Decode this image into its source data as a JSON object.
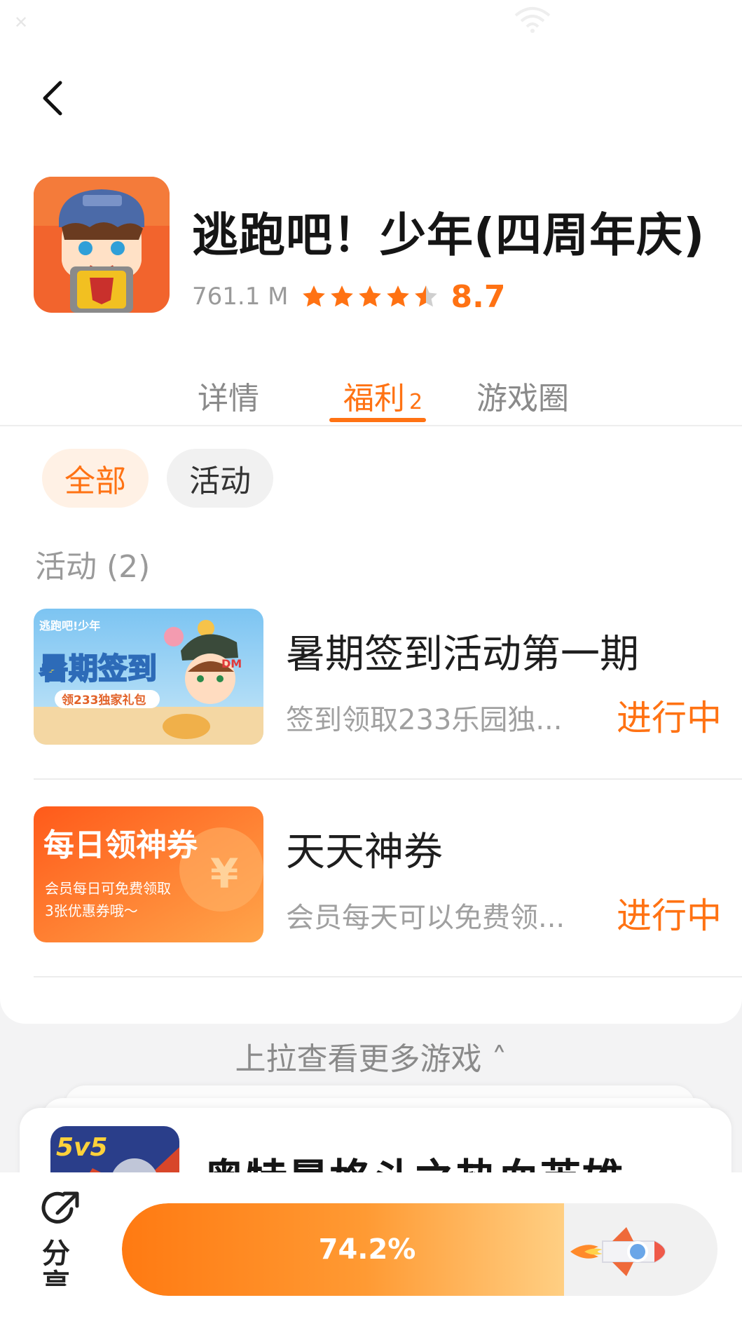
{
  "status_bar": {
    "left_glyph": "✕"
  },
  "header": {
    "back_icon": "chevron-left-icon"
  },
  "app": {
    "title": "逃跑吧！少年(四周年庆)",
    "size": "761.1 M",
    "rating": {
      "stars": 4.5,
      "score": "8.7"
    },
    "colors": {
      "accent": "#ff7213"
    }
  },
  "tabs": [
    {
      "label": "详情",
      "active": false
    },
    {
      "label": "福利",
      "badge": "2",
      "active": true
    },
    {
      "label": "游戏圈",
      "active": false
    }
  ],
  "filters": [
    {
      "label": "全部",
      "selected": true
    },
    {
      "label": "活动",
      "selected": false
    }
  ],
  "section": {
    "title": "活动 (2)"
  },
  "activities": [
    {
      "title": "暑期签到活动第一期",
      "desc": "签到领取233乐园独...",
      "status": "进行中",
      "banner": {
        "badge": "逃跑吧!少年",
        "headline": "暑期签到",
        "sub": "领233独家礼包",
        "cap_text": "DM"
      }
    },
    {
      "title": "天天神券",
      "desc": "会员每天可以免费领...",
      "status": "进行中",
      "banner": {
        "headline": "每日领神券",
        "line1": "会员每日可免费领取",
        "line2": "3张优惠券哦～",
        "symbol": "¥"
      }
    }
  ],
  "pull_more": {
    "label": "上拉查看更多游戏 ˄"
  },
  "next_game": {
    "title": "奥特曼格斗之热血英雄",
    "icon_text": "5v5"
  },
  "bottom": {
    "share_label": "分享",
    "progress": {
      "value": 0.742,
      "label": "74.2%"
    }
  }
}
